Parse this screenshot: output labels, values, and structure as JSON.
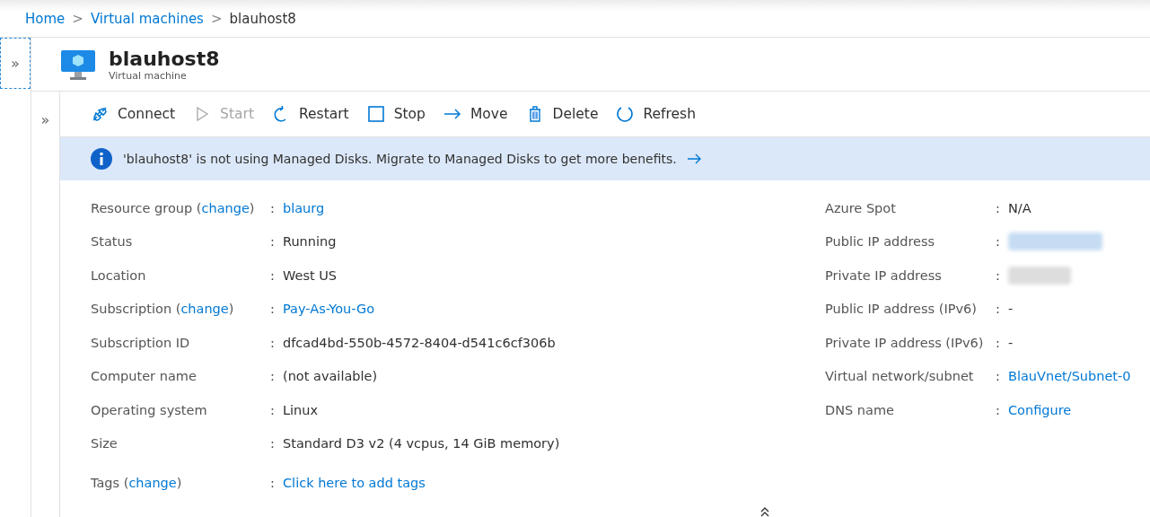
{
  "breadcrumb": [
    {
      "label": "Home",
      "link": true
    },
    {
      "label": "Virtual machines",
      "link": true
    },
    {
      "label": "blauhost8",
      "link": false
    }
  ],
  "breadcrumb_separator": ">",
  "expand_glyph": "»",
  "resource": {
    "name": "blauhost8",
    "type": "Virtual machine"
  },
  "toolbar": [
    {
      "kind": "connect",
      "label": "Connect",
      "disabled": false
    },
    {
      "kind": "start",
      "label": "Start",
      "disabled": true
    },
    {
      "kind": "restart",
      "label": "Restart",
      "disabled": false
    },
    {
      "kind": "stop",
      "label": "Stop",
      "disabled": false
    },
    {
      "kind": "move",
      "label": "Move",
      "disabled": false
    },
    {
      "kind": "delete",
      "label": "Delete",
      "disabled": false
    },
    {
      "kind": "refresh",
      "label": "Refresh",
      "disabled": false
    }
  ],
  "banner": {
    "text": "'blauhost8' is not using Managed Disks. Migrate to Managed Disks to get more benefits."
  },
  "properties_left": [
    {
      "label": "Resource group (",
      "change": "change",
      "label_end": ")",
      "separator": ":",
      "value": "blaurg",
      "kind": "link"
    },
    {
      "label": "Status",
      "separator": ":",
      "value": "Running",
      "kind": "text"
    },
    {
      "label": "Location",
      "separator": ":",
      "value": "West US",
      "kind": "text"
    },
    {
      "label": "Subscription (",
      "change": "change",
      "label_end": ")",
      "separator": ":",
      "value": "Pay-As-You-Go",
      "kind": "link"
    },
    {
      "label": "Subscription ID",
      "separator": ":",
      "value": "dfcad4bd-550b-4572-8404-d541c6cf306b",
      "kind": "text"
    },
    {
      "label": "Computer name",
      "separator": ":",
      "value": "(not available)",
      "kind": "text"
    },
    {
      "label": "Operating system",
      "separator": ":",
      "value": "Linux",
      "kind": "text"
    },
    {
      "label": "Size",
      "separator": ":",
      "value": "Standard D3 v2 (4 vcpus, 14 GiB memory)",
      "kind": "text"
    },
    {
      "label": "Tags (",
      "change": "change",
      "label_end": ")",
      "separator": ":",
      "value": "Click here to add tags",
      "kind": "link"
    }
  ],
  "properties_right": [
    {
      "label": "Azure Spot",
      "separator": ":",
      "value": "N/A",
      "kind": "text"
    },
    {
      "label": "Public IP address",
      "separator": ":",
      "kind": "redacted-link"
    },
    {
      "label": "Private IP address",
      "separator": ":",
      "kind": "redacted"
    },
    {
      "label": "Public IP address (IPv6)",
      "separator": ":",
      "value": "-",
      "kind": "text"
    },
    {
      "label": "Private IP address (IPv6)",
      "separator": ":",
      "value": "-",
      "kind": "text"
    },
    {
      "label": "Virtual network/subnet",
      "separator": ":",
      "value": "BlauVnet/Subnet-0",
      "kind": "link"
    },
    {
      "label": "DNS name",
      "separator": ":",
      "value": "Configure",
      "kind": "link"
    }
  ]
}
